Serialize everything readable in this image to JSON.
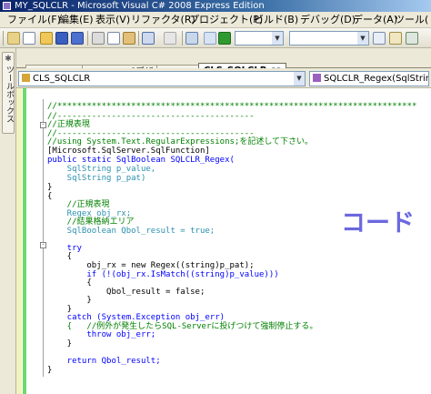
{
  "window": {
    "title": "MY_SQLCLR - Microsoft Visual C# 2008 Express Edition"
  },
  "menu": [
    "ファイル(F)",
    "編集(E)",
    "表示(V)",
    "リファクタ(R)",
    "プロジェクト(P)",
    "ビルド(B)",
    "デバッグ(D)",
    "データ(A)",
    "ツール("
  ],
  "toolbox": {
    "label": "ツールボックス"
  },
  "tabs": [
    "Program.cs",
    "Form1.cs [デザイン]",
    "Form1.cs",
    "CLS_SQLCLR.cs"
  ],
  "active_tab": "CLS_SQLCLR.cs",
  "nav": {
    "left": "CLS_SQLCLR",
    "right": "SQLCLR_Regex(SqlString p_valu"
  },
  "annotation": "コード",
  "code": [
    "//*************************************************************************",
    "//----------------------------------------",
    "//正規表現",
    "//----------------------------------------",
    "//using System.Text.RegularExpressions;を記述して下さい。",
    "[Microsoft.SqlServer.SqlFunction]",
    "public static SqlBoolean SQLCLR_Regex(",
    "    SqlString p_value,",
    "    SqlString p_pat)",
    "}",
    "{",
    "    //正規表現",
    "    Regex obj_rx;",
    "    //結果格納エリア",
    "    SqlBoolean Qbol_result = true;",
    "",
    "    try",
    "    {",
    "        obj_rx = new Regex((string)p_pat);",
    "        if (!(obj_rx.IsMatch((string)p_value)))",
    "        {",
    "            Qbol_result = false;",
    "        }",
    "    }",
    "    catch (System.Exception obj_err)",
    "    {   //例外が発生したらSQL-Serverに投げつけて強制停止する。",
    "        throw obj_err;",
    "    }",
    "",
    "    return Qbol_result;",
    "}"
  ]
}
